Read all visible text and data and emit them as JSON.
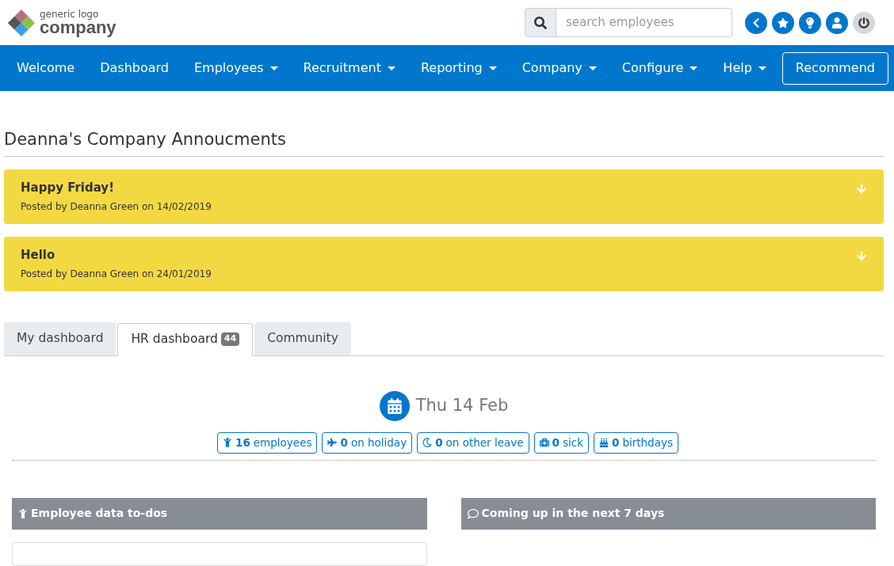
{
  "logo": {
    "small": "generic logo",
    "big": "company"
  },
  "search": {
    "placeholder": "search employees"
  },
  "nav": [
    {
      "label": "Welcome",
      "has_menu": false
    },
    {
      "label": "Dashboard",
      "has_menu": false
    },
    {
      "label": "Employees",
      "has_menu": true
    },
    {
      "label": "Recruitment",
      "has_menu": true
    },
    {
      "label": "Reporting",
      "has_menu": true
    },
    {
      "label": "Company",
      "has_menu": true
    },
    {
      "label": "Configure",
      "has_menu": true
    },
    {
      "label": "Help",
      "has_menu": true
    }
  ],
  "nav_button": "Recommend",
  "announcements_title": "Deanna's Company Annoucments",
  "announcements": [
    {
      "title": "Happy Friday!",
      "meta": "Posted by Deanna Green on 14/02/2019"
    },
    {
      "title": "Hello",
      "meta": "Posted by Deanna Green on 24/01/2019"
    }
  ],
  "tabs": [
    {
      "label": "My dashboard",
      "selected": false
    },
    {
      "label": "HR dashboard",
      "badge": "44",
      "selected": true
    },
    {
      "label": "Community",
      "selected": false
    }
  ],
  "date": "Thu 14 Feb",
  "stats": [
    {
      "kind": "person",
      "count": "16",
      "label": "employees"
    },
    {
      "kind": "plane",
      "count": "0",
      "label": "on holiday"
    },
    {
      "kind": "moon",
      "count": "0",
      "label": "on other leave"
    },
    {
      "kind": "medkit",
      "count": "0",
      "label": "sick"
    },
    {
      "kind": "cake",
      "count": "0",
      "label": "birthdays"
    }
  ],
  "panels": [
    {
      "kind": "person",
      "title": "Employee data to-dos"
    },
    {
      "kind": "comment",
      "title": "Coming up in the next 7 days"
    }
  ]
}
